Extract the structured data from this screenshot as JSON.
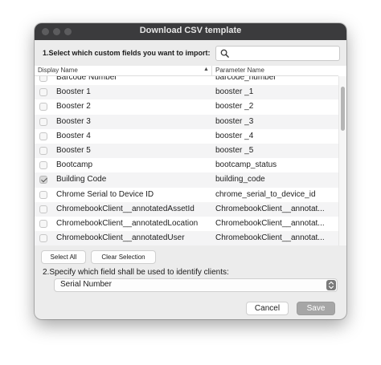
{
  "window": {
    "title": "Download CSV template"
  },
  "section1": {
    "prompt": "1.Select which custom fields you want to import:",
    "search": {
      "value": "",
      "placeholder": ""
    }
  },
  "table": {
    "columns": [
      "Display Name",
      "Parameter Name"
    ],
    "rows": [
      {
        "display": "Barcode Number",
        "param": "barcode_number",
        "checked": false
      },
      {
        "display": "Booster 1",
        "param": "booster _1",
        "checked": false
      },
      {
        "display": "Booster 2",
        "param": "booster _2",
        "checked": false
      },
      {
        "display": "Booster 3",
        "param": "booster _3",
        "checked": false
      },
      {
        "display": "Booster 4",
        "param": "booster _4",
        "checked": false
      },
      {
        "display": "Booster 5",
        "param": "booster _5",
        "checked": false
      },
      {
        "display": "Bootcamp",
        "param": "bootcamp_status",
        "checked": false
      },
      {
        "display": "Building Code",
        "param": "building_code",
        "checked": true
      },
      {
        "display": "Chrome Serial to Device ID",
        "param": "chrome_serial_to_device_id",
        "checked": false
      },
      {
        "display": "ChromebookClient__annotatedAssetId",
        "param": "ChromebookClient__annotat...",
        "checked": false
      },
      {
        "display": "ChromebookClient__annotatedLocation",
        "param": "ChromebookClient__annotat...",
        "checked": false
      },
      {
        "display": "ChromebookClient__annotatedUser",
        "param": "ChromebookClient__annotat...",
        "checked": false
      }
    ]
  },
  "selection_buttons": {
    "select_all": "Select All",
    "clear_selection": "Clear Selection"
  },
  "section2": {
    "prompt": "2.Specify which field shall be used to identify clients:",
    "selected": "Serial Number"
  },
  "footer": {
    "cancel": "Cancel",
    "save": "Save"
  },
  "colors": {
    "titlebar": "#3b3b3d",
    "window_bg": "#ececec",
    "save_disabled": "#a6a6a6"
  }
}
